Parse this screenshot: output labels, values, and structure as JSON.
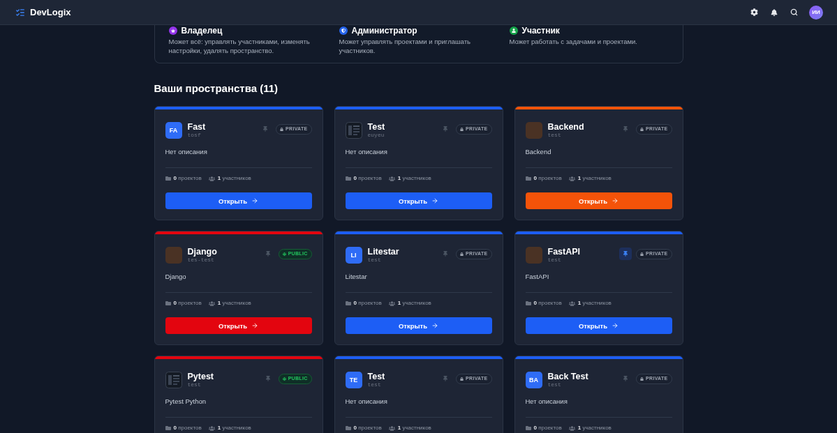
{
  "header": {
    "brand": "DevLogix",
    "avatar": "ИИ"
  },
  "roles": [
    {
      "kind": "owner",
      "title": "Владелец",
      "description": "Может всё: управлять участниками, изменять настройки, удалять пространство.",
      "color": "#9333ea"
    },
    {
      "kind": "admin",
      "title": "Администратор",
      "description": "Может управлять проектами и приглашать участников.",
      "color": "#2563eb"
    },
    {
      "kind": "member",
      "title": "Участник",
      "description": "Может работать с задачами и проектами.",
      "color": "#16a34a"
    }
  ],
  "spaces_heading": "Ваши пространства (11)",
  "spaces": [
    {
      "name": "Fast",
      "slug": "tosf",
      "color": "#1d5ef5",
      "avatar": {
        "kind": "initials",
        "text": "FA"
      },
      "pinned": false,
      "badge": {
        "kind": "private",
        "label": "PRIVATE"
      },
      "description": "Нет описания",
      "projects": "**0** проектов",
      "members": "**1** участников",
      "button": "Открыть"
    },
    {
      "name": "Test",
      "slug": "euyeu",
      "color": "#1d5ef5",
      "avatar": {
        "kind": "thumbnail"
      },
      "pinned": false,
      "badge": {
        "kind": "private",
        "label": "PRIVATE"
      },
      "description": "Нет описания",
      "projects": "**0** проектов",
      "members": "**1** участников",
      "button": "Открыть"
    },
    {
      "name": "Backend",
      "slug": "test",
      "color": "#f45309",
      "avatar": {
        "kind": "photo"
      },
      "pinned": false,
      "badge": {
        "kind": "private",
        "label": "PRIVATE"
      },
      "description": "Backend",
      "projects": "**0** проектов",
      "members": "**1** участников",
      "button": "Открыть"
    },
    {
      "name": "Django",
      "slug": "tes-test",
      "color": "#e3050f",
      "avatar": {
        "kind": "photo"
      },
      "pinned": false,
      "badge": {
        "kind": "public",
        "label": "PUBLIC"
      },
      "description": "Django",
      "projects": "**0** проектов",
      "members": "**1** участников",
      "button": "Открыть"
    },
    {
      "name": "Litestar",
      "slug": "test",
      "color": "#1d5ef5",
      "avatar": {
        "kind": "initials",
        "text": "LI"
      },
      "pinned": false,
      "badge": {
        "kind": "private",
        "label": "PRIVATE"
      },
      "description": "Litestar",
      "projects": "**0** проектов",
      "members": "**1** участников",
      "button": "Открыть"
    },
    {
      "name": "FastAPI",
      "slug": "test",
      "color": "#1d5ef5",
      "avatar": {
        "kind": "photo"
      },
      "pinned": true,
      "badge": {
        "kind": "private",
        "label": "PRIVATE"
      },
      "description": "FastAPI",
      "projects": "**0** проектов",
      "members": "**1** участников",
      "button": "Открыть"
    },
    {
      "name": "Pytest",
      "slug": "test",
      "color": "#e3050f",
      "avatar": {
        "kind": "thumbnail"
      },
      "pinned": false,
      "badge": {
        "kind": "public",
        "label": "PUBLIC"
      },
      "description": "Pytest Python",
      "projects": "**0** проектов",
      "members": "**1** участников"
    },
    {
      "name": "Test",
      "slug": "test",
      "color": "#1d5ef5",
      "avatar": {
        "kind": "initials",
        "text": "TE"
      },
      "pinned": false,
      "badge": {
        "kind": "private",
        "label": "PRIVATE"
      },
      "description": "Нет описания",
      "projects": "**0** проектов",
      "members": "**1** участников"
    },
    {
      "name": "Back Test",
      "slug": "test",
      "color": "#1d5ef5",
      "avatar": {
        "kind": "initials",
        "text": "BA"
      },
      "pinned": false,
      "badge": {
        "kind": "private",
        "label": "PRIVATE"
      },
      "description": "Нет описания",
      "projects": "**0** проектов",
      "members": "**1** участников"
    }
  ]
}
